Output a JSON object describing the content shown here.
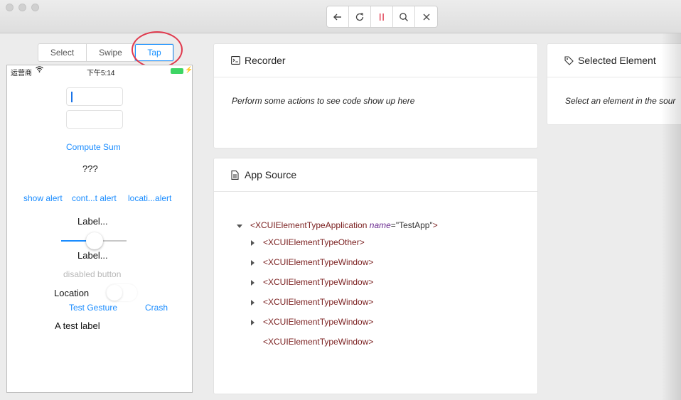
{
  "toolbar": {
    "buttons": [
      {
        "name": "back-icon"
      },
      {
        "name": "refresh-icon"
      },
      {
        "name": "pause-icon"
      },
      {
        "name": "search-icon"
      },
      {
        "name": "close-icon"
      }
    ],
    "pause_color": "#e03a4e"
  },
  "modes": {
    "items": [
      "Select",
      "Swipe",
      "Tap"
    ],
    "active": "Tap",
    "accent": "#1890ff",
    "highlight_circle_color": "#e03a4e"
  },
  "phone": {
    "carrier": "运营商",
    "time": "下午5:14",
    "compute_sum": "Compute Sum",
    "answer": "???",
    "alerts": [
      "show alert",
      "cont...t alert",
      "locati...alert"
    ],
    "label_1": "Label...",
    "label_2": "Label...",
    "disabled_button": "disabled button",
    "location": "Location",
    "test_gesture": "Test Gesture",
    "crash": "Crash",
    "test_label": "A test label"
  },
  "recorder": {
    "title": "Recorder",
    "message": "Perform some actions to see code show up here"
  },
  "selected_element": {
    "title": "Selected Element",
    "message": "Select an element in the sour"
  },
  "app_source": {
    "title": "App Source",
    "root": {
      "open": "<XCUIElementTypeApplication",
      "attr_name": "name",
      "attr_eq": "=",
      "attr_value": "\"TestApp\"",
      "close": ">"
    },
    "children": [
      "<XCUIElementTypeOther>",
      "<XCUIElementTypeWindow>",
      "<XCUIElementTypeWindow>",
      "<XCUIElementTypeWindow>",
      "<XCUIElementTypeWindow>",
      "<XCUIElementTypeWindow>"
    ]
  }
}
